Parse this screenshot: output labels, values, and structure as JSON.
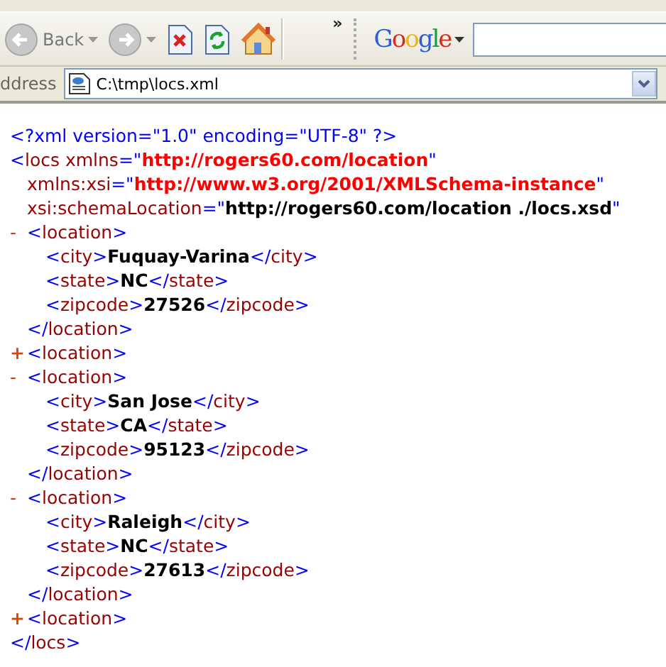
{
  "toolbar": {
    "back_label": "Back",
    "chevron": "»",
    "search_brand": "Google"
  },
  "address": {
    "label": "ddress",
    "value": "C:\\tmp\\locs.xml"
  },
  "document": [
    {
      "open": [
        [
          {
            "kind": "punct",
            "t": "<?xml version=\"1.0\" encoding=\"UTF-8\" ?>"
          }
        ]
      ]
    },
    {
      "open": [
        [
          {
            "kind": "punct",
            "t": "<"
          },
          {
            "kind": "name",
            "t": "locs xmlns"
          },
          {
            "kind": "punct",
            "t": "=\""
          },
          {
            "kind": "attr_value",
            "t": "http://rogers60.com/location"
          },
          {
            "kind": "punct",
            "t": "\""
          }
        ],
        [
          {
            "kind": "name",
            "t": "xmlns:xsi"
          },
          {
            "kind": "punct",
            "t": "=\""
          },
          {
            "kind": "attr_value",
            "t": "http://www.w3.org/2001/XMLSchema-instance"
          },
          {
            "kind": "punct",
            "t": "\""
          }
        ],
        [
          {
            "kind": "name",
            "t": "xsi:schemaLocation"
          },
          {
            "kind": "punct",
            "t": "=\""
          },
          {
            "kind": "content",
            "t": "http://rogers60.com/location ./locs.xsd"
          },
          {
            "kind": "punct",
            "t": "\""
          }
        ]
      ],
      "children": [
        {
          "marker": "-",
          "expanded": true,
          "open": [
            [
              {
                "kind": "punct",
                "t": "<"
              },
              {
                "kind": "name",
                "t": "location"
              },
              {
                "kind": "punct",
                "t": ">"
              }
            ]
          ],
          "children": [
            {
              "open": [
                [
                  {
                    "kind": "punct",
                    "t": "<"
                  },
                  {
                    "kind": "name",
                    "t": "city"
                  },
                  {
                    "kind": "punct",
                    "t": ">"
                  },
                  {
                    "kind": "content",
                    "t": "Fuquay-Varina"
                  },
                  {
                    "kind": "punct",
                    "t": "</"
                  },
                  {
                    "kind": "name",
                    "t": "city"
                  },
                  {
                    "kind": "punct",
                    "t": ">"
                  }
                ]
              ]
            },
            {
              "open": [
                [
                  {
                    "kind": "punct",
                    "t": "<"
                  },
                  {
                    "kind": "name",
                    "t": "state"
                  },
                  {
                    "kind": "punct",
                    "t": ">"
                  },
                  {
                    "kind": "content",
                    "t": "NC"
                  },
                  {
                    "kind": "punct",
                    "t": "</"
                  },
                  {
                    "kind": "name",
                    "t": "state"
                  },
                  {
                    "kind": "punct",
                    "t": ">"
                  }
                ]
              ]
            },
            {
              "open": [
                [
                  {
                    "kind": "punct",
                    "t": "<"
                  },
                  {
                    "kind": "name",
                    "t": "zipcode"
                  },
                  {
                    "kind": "punct",
                    "t": ">"
                  },
                  {
                    "kind": "content",
                    "t": "27526"
                  },
                  {
                    "kind": "punct",
                    "t": "</"
                  },
                  {
                    "kind": "name",
                    "t": "zipcode"
                  },
                  {
                    "kind": "punct",
                    "t": ">"
                  }
                ]
              ]
            }
          ],
          "close": [
            {
              "kind": "punct",
              "t": "</"
            },
            {
              "kind": "name",
              "t": "location"
            },
            {
              "kind": "punct",
              "t": ">"
            }
          ]
        },
        {
          "marker": "+",
          "expanded": false,
          "open": [
            [
              {
                "kind": "punct",
                "t": "<"
              },
              {
                "kind": "name",
                "t": "location"
              },
              {
                "kind": "punct",
                "t": ">"
              }
            ]
          ]
        },
        {
          "marker": "-",
          "expanded": true,
          "open": [
            [
              {
                "kind": "punct",
                "t": "<"
              },
              {
                "kind": "name",
                "t": "location"
              },
              {
                "kind": "punct",
                "t": ">"
              }
            ]
          ],
          "children": [
            {
              "open": [
                [
                  {
                    "kind": "punct",
                    "t": "<"
                  },
                  {
                    "kind": "name",
                    "t": "city"
                  },
                  {
                    "kind": "punct",
                    "t": ">"
                  },
                  {
                    "kind": "content",
                    "t": "San Jose"
                  },
                  {
                    "kind": "punct",
                    "t": "</"
                  },
                  {
                    "kind": "name",
                    "t": "city"
                  },
                  {
                    "kind": "punct",
                    "t": ">"
                  }
                ]
              ]
            },
            {
              "open": [
                [
                  {
                    "kind": "punct",
                    "t": "<"
                  },
                  {
                    "kind": "name",
                    "t": "state"
                  },
                  {
                    "kind": "punct",
                    "t": ">"
                  },
                  {
                    "kind": "content",
                    "t": "CA"
                  },
                  {
                    "kind": "punct",
                    "t": "</"
                  },
                  {
                    "kind": "name",
                    "t": "state"
                  },
                  {
                    "kind": "punct",
                    "t": ">"
                  }
                ]
              ]
            },
            {
              "open": [
                [
                  {
                    "kind": "punct",
                    "t": "<"
                  },
                  {
                    "kind": "name",
                    "t": "zipcode"
                  },
                  {
                    "kind": "punct",
                    "t": ">"
                  },
                  {
                    "kind": "content",
                    "t": "95123"
                  },
                  {
                    "kind": "punct",
                    "t": "</"
                  },
                  {
                    "kind": "name",
                    "t": "zipcode"
                  },
                  {
                    "kind": "punct",
                    "t": ">"
                  }
                ]
              ]
            }
          ],
          "close": [
            {
              "kind": "punct",
              "t": "</"
            },
            {
              "kind": "name",
              "t": "location"
            },
            {
              "kind": "punct",
              "t": ">"
            }
          ]
        },
        {
          "marker": "-",
          "expanded": true,
          "open": [
            [
              {
                "kind": "punct",
                "t": "<"
              },
              {
                "kind": "name",
                "t": "location"
              },
              {
                "kind": "punct",
                "t": ">"
              }
            ]
          ],
          "children": [
            {
              "open": [
                [
                  {
                    "kind": "punct",
                    "t": "<"
                  },
                  {
                    "kind": "name",
                    "t": "city"
                  },
                  {
                    "kind": "punct",
                    "t": ">"
                  },
                  {
                    "kind": "content",
                    "t": "Raleigh"
                  },
                  {
                    "kind": "punct",
                    "t": "</"
                  },
                  {
                    "kind": "name",
                    "t": "city"
                  },
                  {
                    "kind": "punct",
                    "t": ">"
                  }
                ]
              ]
            },
            {
              "open": [
                [
                  {
                    "kind": "punct",
                    "t": "<"
                  },
                  {
                    "kind": "name",
                    "t": "state"
                  },
                  {
                    "kind": "punct",
                    "t": ">"
                  },
                  {
                    "kind": "content",
                    "t": "NC"
                  },
                  {
                    "kind": "punct",
                    "t": "</"
                  },
                  {
                    "kind": "name",
                    "t": "state"
                  },
                  {
                    "kind": "punct",
                    "t": ">"
                  }
                ]
              ]
            },
            {
              "open": [
                [
                  {
                    "kind": "punct",
                    "t": "<"
                  },
                  {
                    "kind": "name",
                    "t": "zipcode"
                  },
                  {
                    "kind": "punct",
                    "t": ">"
                  },
                  {
                    "kind": "content",
                    "t": "27613"
                  },
                  {
                    "kind": "punct",
                    "t": "</"
                  },
                  {
                    "kind": "name",
                    "t": "zipcode"
                  },
                  {
                    "kind": "punct",
                    "t": ">"
                  }
                ]
              ]
            }
          ],
          "close": [
            {
              "kind": "punct",
              "t": "</"
            },
            {
              "kind": "name",
              "t": "location"
            },
            {
              "kind": "punct",
              "t": ">"
            }
          ]
        },
        {
          "marker": "+",
          "expanded": false,
          "open": [
            [
              {
                "kind": "punct",
                "t": "<"
              },
              {
                "kind": "name",
                "t": "location"
              },
              {
                "kind": "punct",
                "t": ">"
              }
            ]
          ]
        }
      ],
      "close": [
        {
          "kind": "punct",
          "t": "</"
        },
        {
          "kind": "name",
          "t": "locs"
        },
        {
          "kind": "punct",
          "t": ">"
        }
      ]
    }
  ]
}
